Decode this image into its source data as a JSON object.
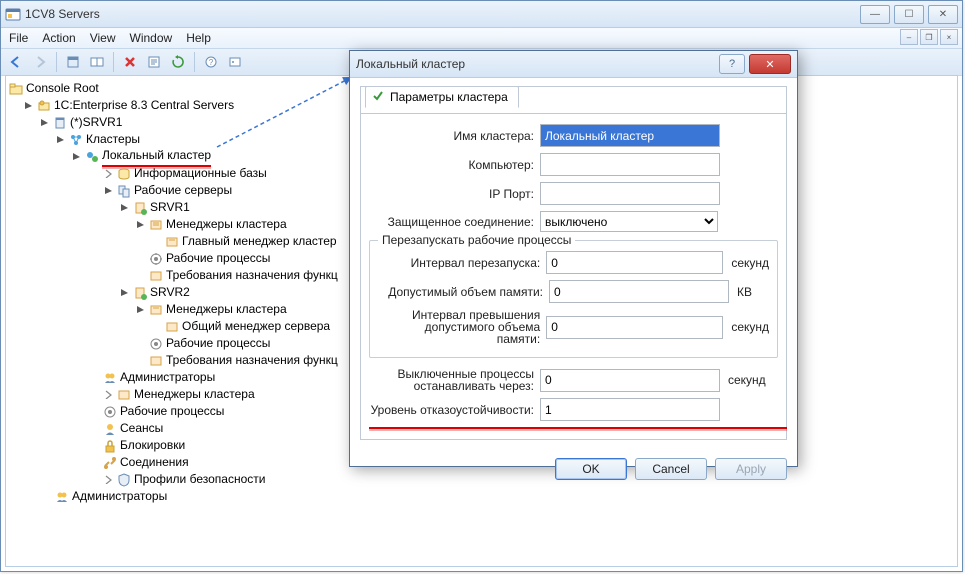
{
  "window": {
    "title": "1CV8 Servers"
  },
  "menu": {
    "file": "File",
    "action": "Action",
    "view": "View",
    "window": "Window",
    "help": "Help"
  },
  "tree": {
    "root": "Console Root",
    "central": "1C:Enterprise 8.3 Central Servers",
    "srvr1": "(*)SRVR1",
    "clusters": "Кластеры",
    "local_cluster": "Локальный кластер",
    "info_bases": "Информационные базы",
    "work_servers": "Рабочие серверы",
    "srvr1n": "SRVR1",
    "managers1": "Менеджеры кластера",
    "main_manager": "Главный менеджер кластер",
    "work_processes1": "Рабочие процессы",
    "assignment_req1": "Требования назначения функц",
    "srvr2": "SRVR2",
    "managers2": "Менеджеры кластера",
    "common_manager": "Общий менеджер сервера",
    "work_processes2": "Рабочие процессы",
    "assignment_req2": "Требования назначения функц",
    "admins": "Администраторы",
    "mgr_clusters": "Менеджеры кластера",
    "wproc": "Рабочие процессы",
    "sessions": "Сеансы",
    "blocks": "Блокировки",
    "connections": "Соединения",
    "sec_profiles": "Профили безопасности",
    "top_admins": "Администраторы"
  },
  "dialog": {
    "title": "Локальный кластер",
    "tab": "Параметры кластера",
    "labels": {
      "name": "Имя кластера:",
      "computer": "Компьютер:",
      "port": "IP Порт:",
      "secure": "Защищенное соединение:",
      "group_restart": "Перезапускать рабочие процессы",
      "interval": "Интервал перезапуска:",
      "mem": "Допустимый объем памяти:",
      "mem_exceed": "Интервал превышения допустимого объема памяти:",
      "stop_disabled": "Выключенные процессы останавливать через:",
      "fault_tolerance": "Уровень отказоустойчивости:"
    },
    "values": {
      "name": "Локальный кластер",
      "computer": "",
      "port": "",
      "secure": "выключено",
      "interval": "0",
      "mem": "0",
      "mem_exceed": "0",
      "stop_disabled": "0",
      "fault_tolerance": "1"
    },
    "units": {
      "sec": "секунд",
      "kb": "КВ"
    },
    "buttons": {
      "ok": "OK",
      "cancel": "Cancel",
      "apply": "Apply"
    }
  }
}
